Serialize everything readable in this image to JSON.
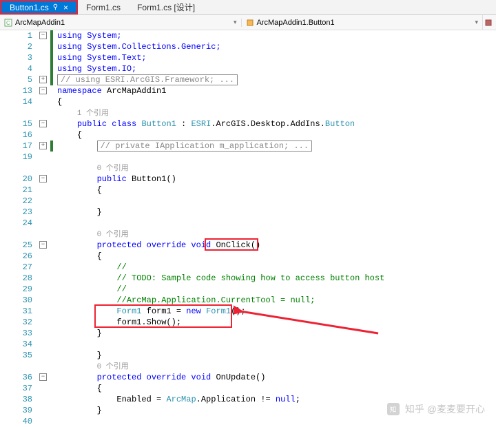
{
  "tabs": [
    {
      "label": "Button1.cs",
      "active": true,
      "pin": "⚲",
      "close": "×"
    },
    {
      "label": "Form1.cs",
      "active": false
    },
    {
      "label": "Form1.cs [设计]",
      "active": false
    }
  ],
  "nav": {
    "left": "ArcMapAddin1",
    "right": "ArcMapAddin1.Button1"
  },
  "watermark": "知乎 @麦麦要开心",
  "code": {
    "ref1": "1 个引用",
    "ref0a": "0 个引用",
    "ref0b": "0 个引用",
    "ref0c": "0 个引用",
    "l1": "using System;",
    "l2": "using System.Collections.Generic;",
    "l3": "using System.Text;",
    "l4": "using System.IO;",
    "l5": "// using ESRI.ArcGIS.Framework; ...",
    "l13a": "namespace ",
    "l13b": "ArcMapAddin1",
    "l14": "{",
    "l15a": "public class ",
    "l15b": "Button1",
    "l15c": " : ",
    "l15d": "ESRI",
    "l15e": ".ArcGIS.Desktop.AddIns.",
    "l15f": "Button",
    "l16": "{",
    "l17": "// private IApplication m_application; ...",
    "l20a": "public",
    "l20b": " Button1()",
    "l21": "{",
    "l23": "}",
    "l25a": "protected override void",
    "l25b": " OnClick",
    "l25c": "()",
    "l26": "{",
    "l27": "//",
    "l28": "// TODO: Sample code showing how to access button host",
    "l29": "//",
    "l30": "//ArcMap.Application.CurrentTool = null;",
    "l31a": "Form1",
    "l31b": " form1 = ",
    "l31c": "new ",
    "l31d": "Form1",
    "l31e": "();",
    "l32": "form1.Show();",
    "l33": "}",
    "l35": "}",
    "l36a": "protected override void",
    "l36b": " OnUpdate()",
    "l37": "{",
    "l38a": "Enabled = ",
    "l38b": "ArcMap",
    "l38c": ".Application != ",
    "l38d": "null",
    "l38e": ";",
    "l39": "}",
    "l40": ""
  },
  "line_numbers": [
    "1",
    "2",
    "3",
    "4",
    "5",
    "13",
    "14",
    "",
    "15",
    "16",
    "17",
    "19",
    "",
    "20",
    "21",
    "22",
    "23",
    "24",
    "",
    "25",
    "26",
    "27",
    "28",
    "29",
    "30",
    "31",
    "32",
    "33",
    "34",
    "35",
    "",
    "36",
    "37",
    "38",
    "39",
    "40"
  ]
}
